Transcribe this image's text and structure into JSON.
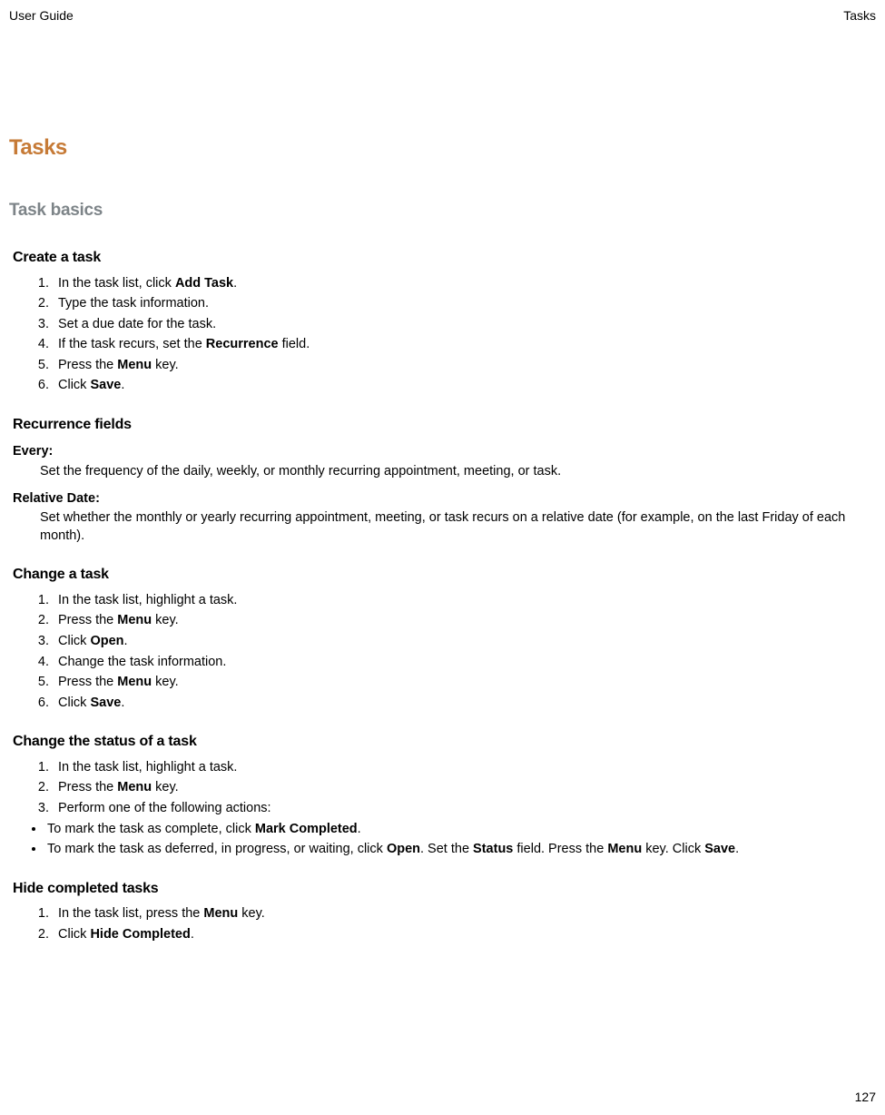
{
  "header": {
    "left": "User Guide",
    "right": "Tasks"
  },
  "pageNumber": "127",
  "h1": "Tasks",
  "h2": "Task basics",
  "sections": {
    "createTask": {
      "heading": "Create a task",
      "steps": {
        "s1a": "In the task list, click ",
        "s1b": "Add Task",
        "s1c": ".",
        "s2": "Type the task information.",
        "s3": "Set a due date for the task.",
        "s4a": "If the task recurs, set the ",
        "s4b": "Recurrence",
        "s4c": " field.",
        "s5a": "Press the ",
        "s5b": "Menu",
        "s5c": " key.",
        "s6a": "Click ",
        "s6b": "Save",
        "s6c": "."
      }
    },
    "recurrence": {
      "heading": "Recurrence fields",
      "every": {
        "term": "Every",
        "desc": "Set the frequency of the daily, weekly, or monthly recurring appointment, meeting, or task."
      },
      "relativeDate": {
        "term": "Relative Date",
        "desc": "Set whether the monthly or yearly recurring appointment, meeting, or task recurs on a relative date (for example, on the last Friday of each month)."
      }
    },
    "changeTask": {
      "heading": "Change a task",
      "steps": {
        "s1": "In the task list, highlight a task.",
        "s2a": "Press the ",
        "s2b": "Menu",
        "s2c": " key.",
        "s3a": "Click ",
        "s3b": "Open",
        "s3c": ".",
        "s4": "Change the task information.",
        "s5a": "Press the ",
        "s5b": "Menu",
        "s5c": " key.",
        "s6a": "Click ",
        "s6b": "Save",
        "s6c": "."
      }
    },
    "changeStatus": {
      "heading": "Change the status of a task",
      "steps": {
        "s1": "In the task list, highlight a task.",
        "s2a": "Press the ",
        "s2b": "Menu",
        "s2c": " key.",
        "s3": "Perform one of the following actions:"
      },
      "bullets": {
        "b1a": "To mark the task as complete, click ",
        "b1b": "Mark Completed",
        "b1c": ".",
        "b2a": "To mark the task as deferred, in progress, or waiting, click ",
        "b2b": "Open",
        "b2c": ". Set the ",
        "b2d": "Status",
        "b2e": " field. Press the ",
        "b2f": "Menu",
        "b2g": " key. Click ",
        "b2h": "Save",
        "b2i": "."
      }
    },
    "hideCompleted": {
      "heading": "Hide completed tasks",
      "steps": {
        "s1a": "In the task list, press the ",
        "s1b": "Menu",
        "s1c": " key.",
        "s2a": "Click ",
        "s2b": "Hide Completed",
        "s2c": "."
      }
    }
  }
}
